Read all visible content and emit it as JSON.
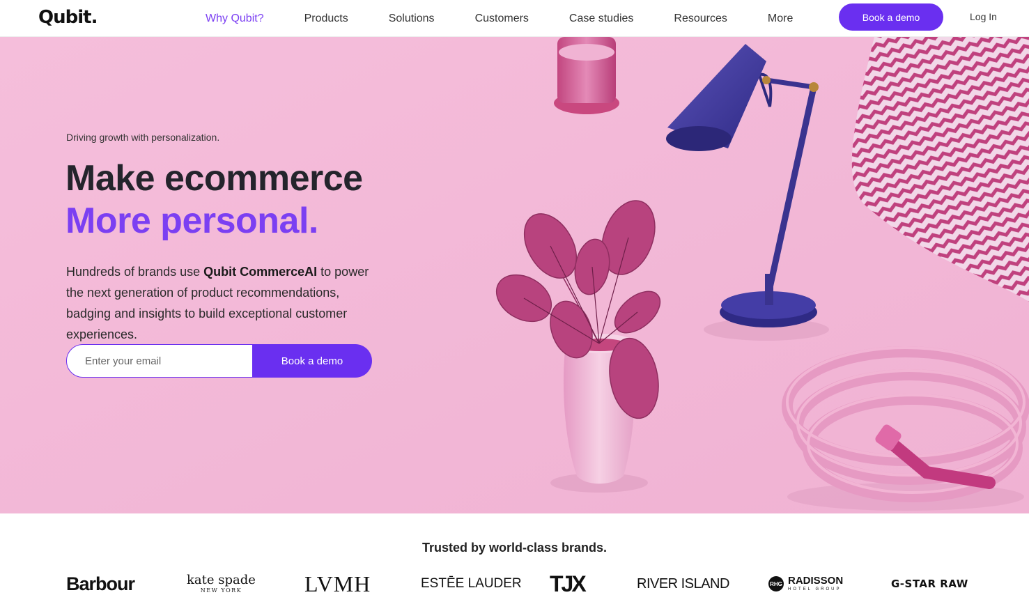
{
  "nav": {
    "logo": "Qubit.",
    "links": [
      {
        "label": "Why Qubit?",
        "active": true
      },
      {
        "label": "Products"
      },
      {
        "label": "Solutions"
      },
      {
        "label": "Customers"
      },
      {
        "label": "Case studies"
      },
      {
        "label": "Resources"
      },
      {
        "label": "More"
      }
    ],
    "cta": "Book a demo",
    "login": "Log In"
  },
  "hero": {
    "eyebrow": "Driving growth with personalization.",
    "headline_1": "Make ecommerce",
    "headline_2": "More personal.",
    "desc_pre": "Hundreds of brands use ",
    "desc_bold": "Qubit CommerceAI",
    "desc_post": " to power the next generation of product recommendations, badging and insights to build exceptional customer experiences.",
    "email_placeholder": "Enter your email",
    "form_button": "Book a demo",
    "colors": {
      "background": "#f4bbd9",
      "accent": "#7b3ff2",
      "button": "#6a2ff0"
    }
  },
  "brands": {
    "title": "Trusted by world-class brands.",
    "logos": {
      "barbour": "Barbour",
      "kate_spade": "kate spade",
      "kate_spade_sub": "NEW YORK",
      "lvmh": "LVMH",
      "estee": "ESTĒE LAUDER",
      "tjx": "TJX",
      "river_island": "RIVER ISLAND",
      "radisson_mark": "RHG",
      "radisson": "RADISSON",
      "radisson_sub": "HOTEL GROUP",
      "gstar": "G-STAR RAW"
    }
  }
}
